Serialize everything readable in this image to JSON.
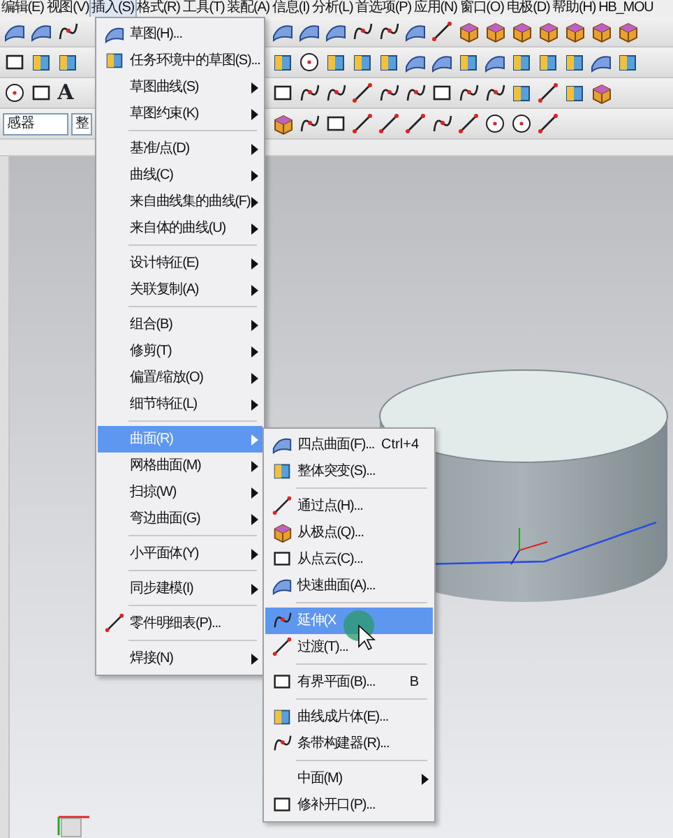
{
  "menubar": [
    {
      "label": "编辑(E)",
      "selected": false
    },
    {
      "label": "视图(V)",
      "selected": false
    },
    {
      "label": "插入(S)",
      "selected": true
    },
    {
      "label": "格式(R)",
      "selected": false
    },
    {
      "label": "工具(T)",
      "selected": false
    },
    {
      "label": "装配(A)",
      "selected": false
    },
    {
      "label": "信息(I)",
      "selected": false
    },
    {
      "label": "分析(L)",
      "selected": false
    },
    {
      "label": "首选项(P)",
      "selected": false
    },
    {
      "label": "应用(N)",
      "selected": false
    },
    {
      "label": "窗口(O)",
      "selected": false
    },
    {
      "label": "电极(D)",
      "selected": false
    },
    {
      "label": "帮助(H)",
      "selected": false
    },
    {
      "label": "HB_MOU",
      "selected": false
    }
  ],
  "toolbar": {
    "text_tool": "A",
    "filter_field": {
      "value": "感器"
    },
    "type_field": {
      "value": "整"
    }
  },
  "insert_menu": [
    {
      "kind": "item",
      "label": "草图(H)...",
      "icon": true,
      "submenu": false,
      "selected": false
    },
    {
      "kind": "item",
      "label": "任务环境中的草图(S)...",
      "icon": true,
      "submenu": false,
      "selected": false
    },
    {
      "kind": "item",
      "label": "草图曲线(S)",
      "icon": false,
      "submenu": true,
      "selected": false
    },
    {
      "kind": "item",
      "label": "草图约束(K)",
      "icon": false,
      "submenu": true,
      "selected": false
    },
    {
      "kind": "separator"
    },
    {
      "kind": "item",
      "label": "基准/点(D)",
      "icon": false,
      "submenu": true,
      "selected": false
    },
    {
      "kind": "item",
      "label": "曲线(C)",
      "icon": false,
      "submenu": true,
      "selected": false
    },
    {
      "kind": "item",
      "label": "来自曲线集的曲线(F)",
      "icon": false,
      "submenu": true,
      "selected": false
    },
    {
      "kind": "item",
      "label": "来自体的曲线(U)",
      "icon": false,
      "submenu": true,
      "selected": false
    },
    {
      "kind": "separator"
    },
    {
      "kind": "item",
      "label": "设计特征(E)",
      "icon": false,
      "submenu": true,
      "selected": false
    },
    {
      "kind": "item",
      "label": "关联复制(A)",
      "icon": false,
      "submenu": true,
      "selected": false
    },
    {
      "kind": "separator"
    },
    {
      "kind": "item",
      "label": "组合(B)",
      "icon": false,
      "submenu": true,
      "selected": false
    },
    {
      "kind": "item",
      "label": "修剪(T)",
      "icon": false,
      "submenu": true,
      "selected": false
    },
    {
      "kind": "item",
      "label": "偏置/缩放(O)",
      "icon": false,
      "submenu": true,
      "selected": false
    },
    {
      "kind": "item",
      "label": "细节特征(L)",
      "icon": false,
      "submenu": true,
      "selected": false
    },
    {
      "kind": "separator"
    },
    {
      "kind": "item",
      "label": "曲面(R)",
      "icon": false,
      "submenu": true,
      "selected": true
    },
    {
      "kind": "item",
      "label": "网格曲面(M)",
      "icon": false,
      "submenu": true,
      "selected": false
    },
    {
      "kind": "item",
      "label": "扫掠(W)",
      "icon": false,
      "submenu": true,
      "selected": false
    },
    {
      "kind": "item",
      "label": "弯边曲面(G)",
      "icon": false,
      "submenu": true,
      "selected": false
    },
    {
      "kind": "separator"
    },
    {
      "kind": "item",
      "label": "小平面体(Y)",
      "icon": false,
      "submenu": true,
      "selected": false
    },
    {
      "kind": "separator"
    },
    {
      "kind": "item",
      "label": "同步建模(I)",
      "icon": false,
      "submenu": true,
      "selected": false
    },
    {
      "kind": "separator"
    },
    {
      "kind": "item",
      "label": "零件明细表(P)...",
      "icon": true,
      "submenu": false,
      "selected": false
    },
    {
      "kind": "separator"
    },
    {
      "kind": "item",
      "label": "焊接(N)",
      "icon": false,
      "submenu": true,
      "selected": false
    }
  ],
  "surface_menu": [
    {
      "kind": "item",
      "label": "四点曲面(F)...",
      "shortcut": "Ctrl+4",
      "icon": true,
      "submenu": false,
      "selected": false
    },
    {
      "kind": "item",
      "label": "整体突变(S)...",
      "icon": true,
      "submenu": false,
      "selected": false
    },
    {
      "kind": "separator"
    },
    {
      "kind": "item",
      "label": "通过点(H)...",
      "icon": true,
      "submenu": false,
      "selected": false
    },
    {
      "kind": "item",
      "label": "从极点(Q)...",
      "icon": true,
      "submenu": false,
      "selected": false
    },
    {
      "kind": "item",
      "label": "从点云(C)...",
      "icon": true,
      "submenu": false,
      "selected": false
    },
    {
      "kind": "item",
      "label": "快速曲面(A)...",
      "icon": true,
      "submenu": false,
      "selected": false
    },
    {
      "kind": "separator"
    },
    {
      "kind": "item",
      "label": "延伸(X",
      "icon": true,
      "submenu": false,
      "selected": true
    },
    {
      "kind": "item",
      "label": "过渡(T)...",
      "icon": true,
      "submenu": false,
      "selected": false
    },
    {
      "kind": "separator"
    },
    {
      "kind": "item",
      "label": "有界平面(B)...",
      "shortcut": "B",
      "icon": true,
      "submenu": false,
      "selected": false
    },
    {
      "kind": "separator"
    },
    {
      "kind": "item",
      "label": "曲线成片体(E)...",
      "icon": true,
      "submenu": false,
      "selected": false
    },
    {
      "kind": "item",
      "label": "条带构建器(R)...",
      "icon": true,
      "submenu": false,
      "selected": false
    },
    {
      "kind": "separator"
    },
    {
      "kind": "item",
      "label": "中面(M)",
      "icon": false,
      "submenu": true,
      "selected": false
    },
    {
      "kind": "item",
      "label": "修补开口(P)...",
      "icon": true,
      "submenu": false,
      "selected": false
    }
  ]
}
